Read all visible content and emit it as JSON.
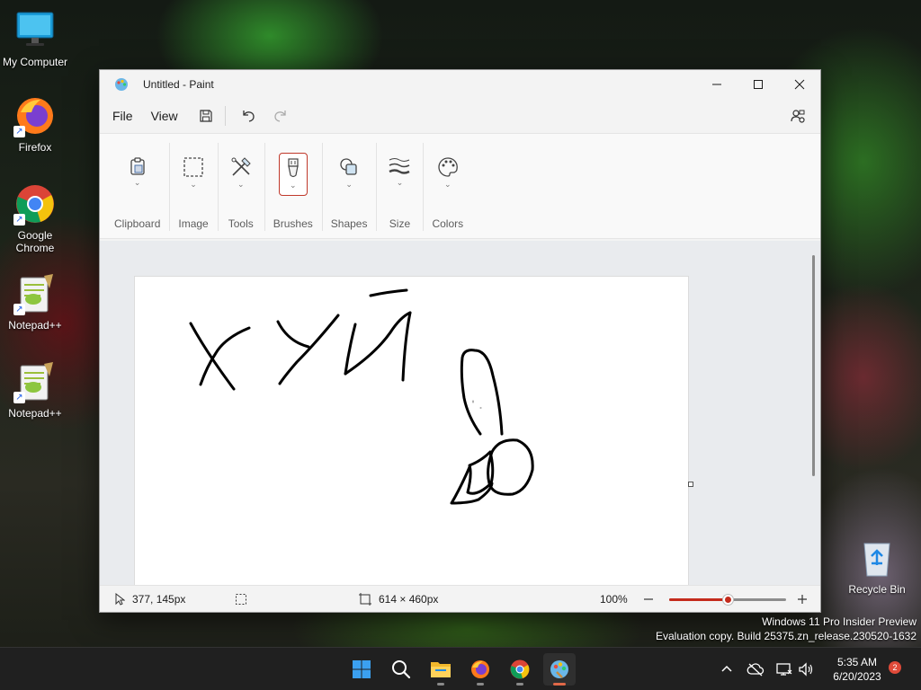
{
  "desktop": {
    "icons": [
      {
        "label": "My Computer",
        "icon": "monitor-icon"
      },
      {
        "label": "Firefox",
        "icon": "firefox-icon"
      },
      {
        "label": "Google Chrome",
        "icon": "chrome-icon"
      },
      {
        "label": "Notepad++",
        "icon": "notepad-plus-plus-icon"
      },
      {
        "label": "Notepad++",
        "icon": "notepad-plus-plus-icon"
      },
      {
        "label": "Recycle Bin",
        "icon": "recycle-bin-icon"
      }
    ]
  },
  "window": {
    "title": "Untitled - Paint",
    "controls": [
      "minimize-icon",
      "maximize-icon",
      "close-icon"
    ]
  },
  "menu": {
    "file": "File",
    "view": "View",
    "icons": [
      "save-icon",
      "undo-icon",
      "redo-icon",
      "account-settings-icon"
    ]
  },
  "ribbon": {
    "groups": [
      {
        "label": "Clipboard",
        "icon": "clipboard-icon"
      },
      {
        "label": "Image",
        "icon": "selection-icon"
      },
      {
        "label": "Tools",
        "icon": "tools-icon"
      },
      {
        "label": "Brushes",
        "icon": "brush-icon",
        "active": true
      },
      {
        "label": "Shapes",
        "icon": "shapes-icon"
      },
      {
        "label": "Size",
        "icon": "line-size-icon"
      },
      {
        "label": "Colors",
        "icon": "palette-icon"
      }
    ]
  },
  "status": {
    "cursor_pos": "377, 145px",
    "canvas_size": "614 × 460px",
    "zoom": "100%",
    "zoom_fraction": 0.5
  },
  "watermark": {
    "line1": "Windows 11 Pro Insider Preview",
    "line2": "Evaluation copy. Build 25375.zn_release.230520-1632"
  },
  "taskbar": {
    "apps": [
      "windows-start-icon",
      "search-icon",
      "file-explorer-icon",
      "firefox-icon",
      "chrome-icon",
      "paint-icon"
    ],
    "time": "5:35 AM",
    "date": "6/20/2023",
    "notifications": "2"
  },
  "colors": {
    "accent": "#c42b1c",
    "taskbar": "#202020"
  }
}
